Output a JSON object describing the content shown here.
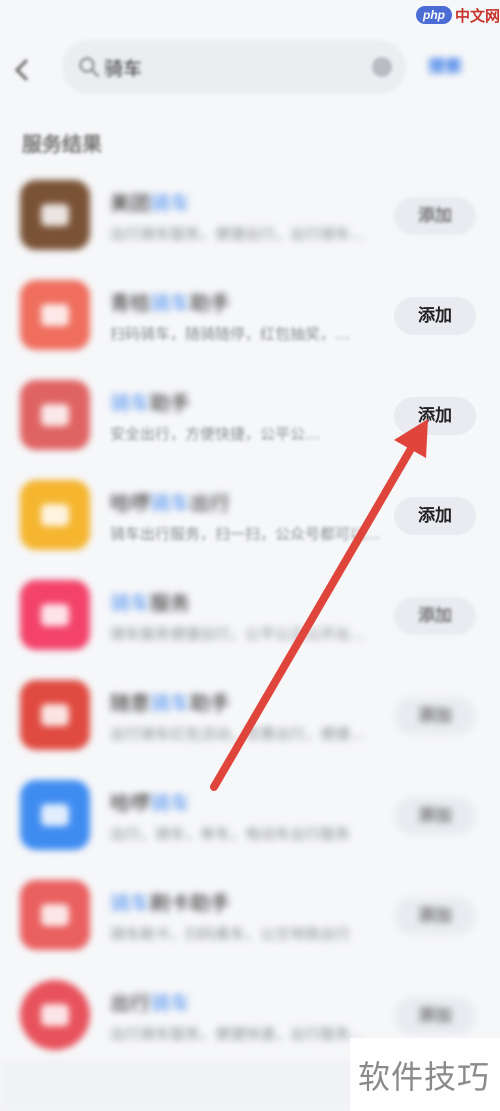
{
  "header": {
    "search_query": "骑车",
    "search_button": "搜索"
  },
  "section_title": "服务结果",
  "items": [
    {
      "title_pre": "美团",
      "title_hl": "骑车",
      "title_post": "",
      "desc": "出行骑车服务，便捷出行，出行骑车...",
      "button": "添加",
      "icon_color": "#7a5236",
      "icon": "bike-app-icon",
      "dim": false
    },
    {
      "title_pre": "青桔",
      "title_hl": "骑车",
      "title_post": "助手",
      "desc": "扫码骑车，随骑随停，红包抽奖，…",
      "button": "添加",
      "icon_color": "#ef6e5e",
      "icon": "bike-app-icon",
      "dim": false
    },
    {
      "title_pre": "",
      "title_hl": "骑车",
      "title_post": "助手",
      "desc": "安全出行，方便快捷，公平公…",
      "button": "添加",
      "icon_color": "#e06363",
      "icon": "bike-app-icon",
      "dim": false
    },
    {
      "title_pre": "哈啰",
      "title_hl": "骑车",
      "title_post": "出行",
      "desc": "骑车出行服务，扫一扫，公众号都可以…",
      "button": "添加",
      "icon_color": "#f5b52f",
      "icon": "bike-app-icon",
      "dim": false
    },
    {
      "title_pre": "",
      "title_hl": "骑车",
      "title_post": "服务",
      "desc": "骑车服务便捷出行，公平公正公开出行服务",
      "button": "添加",
      "icon_color": "#f3436a",
      "icon": "gift-icon",
      "dim": false
    },
    {
      "title_pre": "随意",
      "title_hl": "骑车",
      "title_post": "助手",
      "desc": "出行骑车红包活动，优惠出行，便捷…",
      "button": "添加",
      "icon_color": "#e04a40",
      "icon": "red-envelope-icon",
      "dim": true
    },
    {
      "title_pre": "哈啰",
      "title_hl": "骑车",
      "title_post": "",
      "desc": "出行，骑车，单车，电动车出行服务",
      "button": "添加",
      "icon_color": "#3f8cf1",
      "icon": "cloud-icon",
      "dim": true
    },
    {
      "title_pre": "",
      "title_hl": "骑车",
      "title_post": "刷卡助手",
      "desc": "骑车刷卡，扫码乘车，公交地铁出行",
      "button": "添加",
      "icon_color": "#ea5f5f",
      "icon": "card-icon",
      "dim": true
    },
    {
      "title_pre": "出行",
      "title_hl": "骑车",
      "title_post": "",
      "desc": "出行骑车服务，便捷快速，出行服务…",
      "button": "添加",
      "icon_color": "#e8525c",
      "icon": "mail-icon",
      "dim": true
    }
  ],
  "watermark_top": {
    "badge": "php",
    "text": "中文网"
  },
  "watermark_bottom": "软件技巧",
  "colors": {
    "accent": "#4a8ef0",
    "arrow": "#e0453b"
  }
}
